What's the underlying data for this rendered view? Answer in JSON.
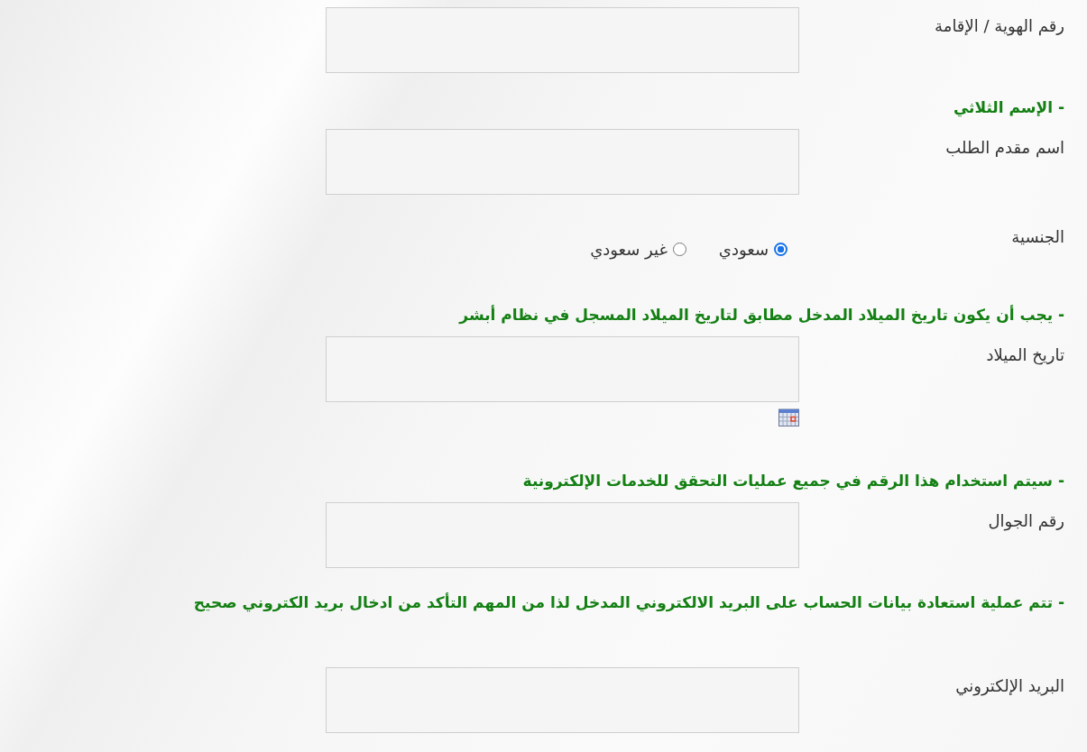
{
  "form": [
    {
      "kind": "text",
      "label": "رقم الهوية / الإقامة"
    },
    {
      "kind": "note",
      "text": "- الإسم الثلاثي"
    },
    {
      "kind": "text",
      "label": "اسم مقدم الطلب"
    },
    {
      "kind": "radio",
      "label": "الجنسية",
      "options": [
        {
          "label": "سعودي",
          "selected": true
        },
        {
          "label": "غير سعودي",
          "selected": false
        }
      ]
    },
    {
      "kind": "note",
      "text": "- يجب أن يكون تاريخ الميلاد المدخل مطابق لتاريخ الميلاد المسجل في نظام أبشر"
    },
    {
      "kind": "date",
      "label": "تاريخ الميلاد"
    },
    {
      "kind": "note",
      "text": "- سيتم استخدام هذا الرقم في جميع عمليات التحقق للخدمات الإلكترونية"
    },
    {
      "kind": "text",
      "label": "رقم الجوال"
    },
    {
      "kind": "note",
      "text": "- تتم عملية استعادة بيانات الحساب على البريد الالكتروني المدخل لذا من المهم التأكد من ادخال بريد الكتروني صحيح"
    },
    {
      "kind": "text",
      "label": "البريد الإلكتروني"
    }
  ]
}
